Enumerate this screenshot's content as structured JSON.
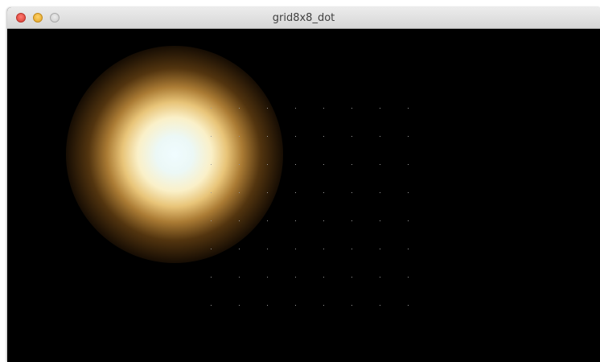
{
  "window": {
    "title": "grid8x8_dot"
  },
  "controls": {
    "close_icon": "close-icon",
    "minimize_icon": "minimize-icon",
    "zoom_icon": "zoom-icon"
  },
  "scene": {
    "grid_rows": 8,
    "grid_cols": 8,
    "dot_color": "#9a9a9a",
    "glow_core_color": "#f0fcff",
    "glow_outer_color": "#b4823a",
    "background_color": "#000000"
  }
}
